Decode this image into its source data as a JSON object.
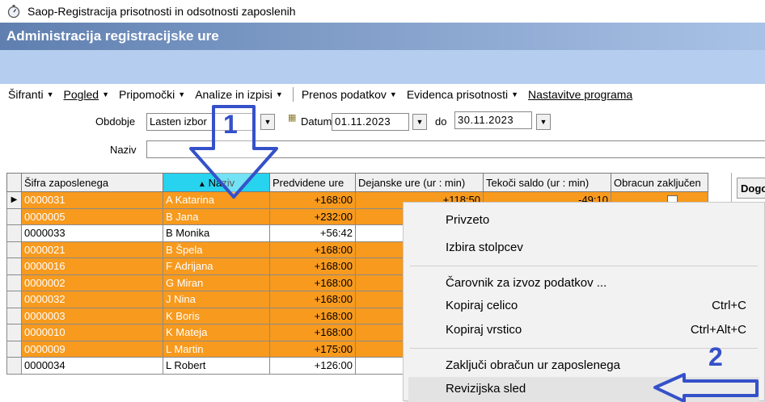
{
  "window": {
    "title": "Saop-Registracija prisotnosti in odsotnosti zaposlenih",
    "subtitle": "Administracija registracijske ure"
  },
  "menu": {
    "items": [
      {
        "label": "Šifranti"
      },
      {
        "label": "Pogled"
      },
      {
        "label": "Pripomočki"
      },
      {
        "label": "Analize in izpisi"
      },
      {
        "label": "Prenos podatkov"
      },
      {
        "label": "Evidenca prisotnosti"
      },
      {
        "label": "Nastavitve programa"
      }
    ]
  },
  "filters": {
    "obdobje_label": "Obdobje",
    "obdobje_value": "Lasten izbor",
    "datum_label": "Datum",
    "datum_from": "01.11.2023",
    "do_label": "do",
    "datum_to": "30.11.2023",
    "naziv_label": "Naziv",
    "naziv_value": ""
  },
  "grid": {
    "columns": [
      "Šifra zaposlenega",
      "Naziv",
      "Predvidene ure",
      "Dejanske ure (ur : min)",
      "Tekoči saldo (ur : min)",
      "Obracun zaključen"
    ],
    "rows": [
      {
        "sifra": "0000031",
        "naziv": "A Katarina",
        "predvidene": "+168:00",
        "dejanske": "+118:50",
        "saldo": "-49:10",
        "color": "orange",
        "current": true
      },
      {
        "sifra": "0000005",
        "naziv": "B Jana",
        "predvidene": "+232:00",
        "dejanske": "",
        "saldo": "",
        "color": "orange"
      },
      {
        "sifra": "0000033",
        "naziv": "B Monika",
        "predvidene": "+56:42",
        "dejanske": "",
        "saldo": "",
        "color": "white"
      },
      {
        "sifra": "0000021",
        "naziv": "B Špela",
        "predvidene": "+168:00",
        "dejanske": "",
        "saldo": "",
        "color": "orange"
      },
      {
        "sifra": "0000016",
        "naziv": "F Adrijana",
        "predvidene": "+168:00",
        "dejanske": "",
        "saldo": "",
        "color": "orange"
      },
      {
        "sifra": "0000002",
        "naziv": "G Miran",
        "predvidene": "+168:00",
        "dejanske": "",
        "saldo": "",
        "color": "orange"
      },
      {
        "sifra": "0000032",
        "naziv": "J Nina",
        "predvidene": "+168:00",
        "dejanske": "",
        "saldo": "",
        "color": "orange"
      },
      {
        "sifra": "0000003",
        "naziv": "K Boris",
        "predvidene": "+168:00",
        "dejanske": "",
        "saldo": "",
        "color": "orange"
      },
      {
        "sifra": "0000010",
        "naziv": "K Mateja",
        "predvidene": "+168:00",
        "dejanske": "",
        "saldo": "",
        "color": "orange"
      },
      {
        "sifra": "0000009",
        "naziv": "L Martin",
        "predvidene": "+175:00",
        "dejanske": "",
        "saldo": "",
        "color": "orange"
      },
      {
        "sifra": "0000034",
        "naziv": "L Robert",
        "predvidene": "+126:00",
        "dejanske": "",
        "saldo": "",
        "color": "white"
      }
    ]
  },
  "right_panel": {
    "header": "Dogo"
  },
  "context_menu": {
    "items": [
      {
        "label": "Privzeto",
        "shortcut": ""
      },
      {
        "label": "Izbira stolpcev",
        "shortcut": ""
      },
      {
        "label": "Čarovnik za izvoz podatkov ...",
        "shortcut": ""
      },
      {
        "label": "Kopiraj celico",
        "shortcut": "Ctrl+C"
      },
      {
        "label": "Kopiraj vrstico",
        "shortcut": "Ctrl+Alt+C"
      },
      {
        "label": "Zaključi obračun ur zaposlenega",
        "shortcut": ""
      },
      {
        "label": "Revizijska sled",
        "shortcut": ""
      }
    ]
  },
  "annotations": {
    "one": "1",
    "two": "2",
    "color": "#3551c9"
  },
  "colors": {
    "orange_row": "#f79a1e",
    "sorted_header": "#27d3ee",
    "band": "#b5cdee"
  }
}
